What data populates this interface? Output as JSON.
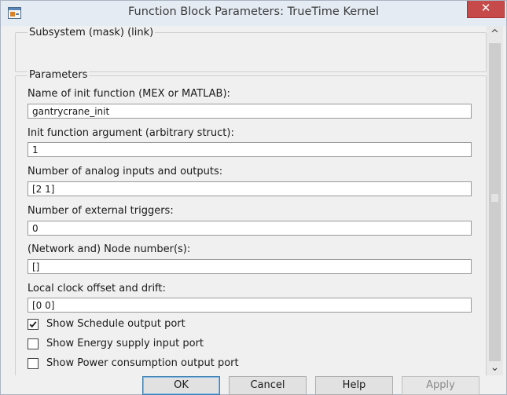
{
  "window": {
    "title": "Function Block Parameters: TrueTime Kernel",
    "close_symbol": "✕"
  },
  "subsystem": {
    "label": "Subsystem (mask) (link)"
  },
  "parameters": {
    "group_label": "Parameters",
    "fields": [
      {
        "label": "Name of init function (MEX or MATLAB):",
        "value": "gantrycrane_init"
      },
      {
        "label": "Init function argument (arbitrary struct):",
        "value": "1"
      },
      {
        "label": "Number of analog inputs and outputs:",
        "value": "[2 1]"
      },
      {
        "label": "Number of external triggers:",
        "value": "0"
      },
      {
        "label": "(Network and) Node number(s):",
        "value": "[]"
      },
      {
        "label": "Local clock offset and drift:",
        "value": "[0 0]"
      }
    ],
    "checkboxes": [
      {
        "label": "Show Schedule output port",
        "checked": true
      },
      {
        "label": "Show Energy supply input port",
        "checked": false
      },
      {
        "label": "Show Power consumption output port",
        "checked": false
      }
    ]
  },
  "buttons": {
    "ok": "OK",
    "cancel": "Cancel",
    "help": "Help",
    "apply": "Apply"
  },
  "scrollbar": {
    "up_symbol": "^",
    "down_symbol": "⌄"
  }
}
